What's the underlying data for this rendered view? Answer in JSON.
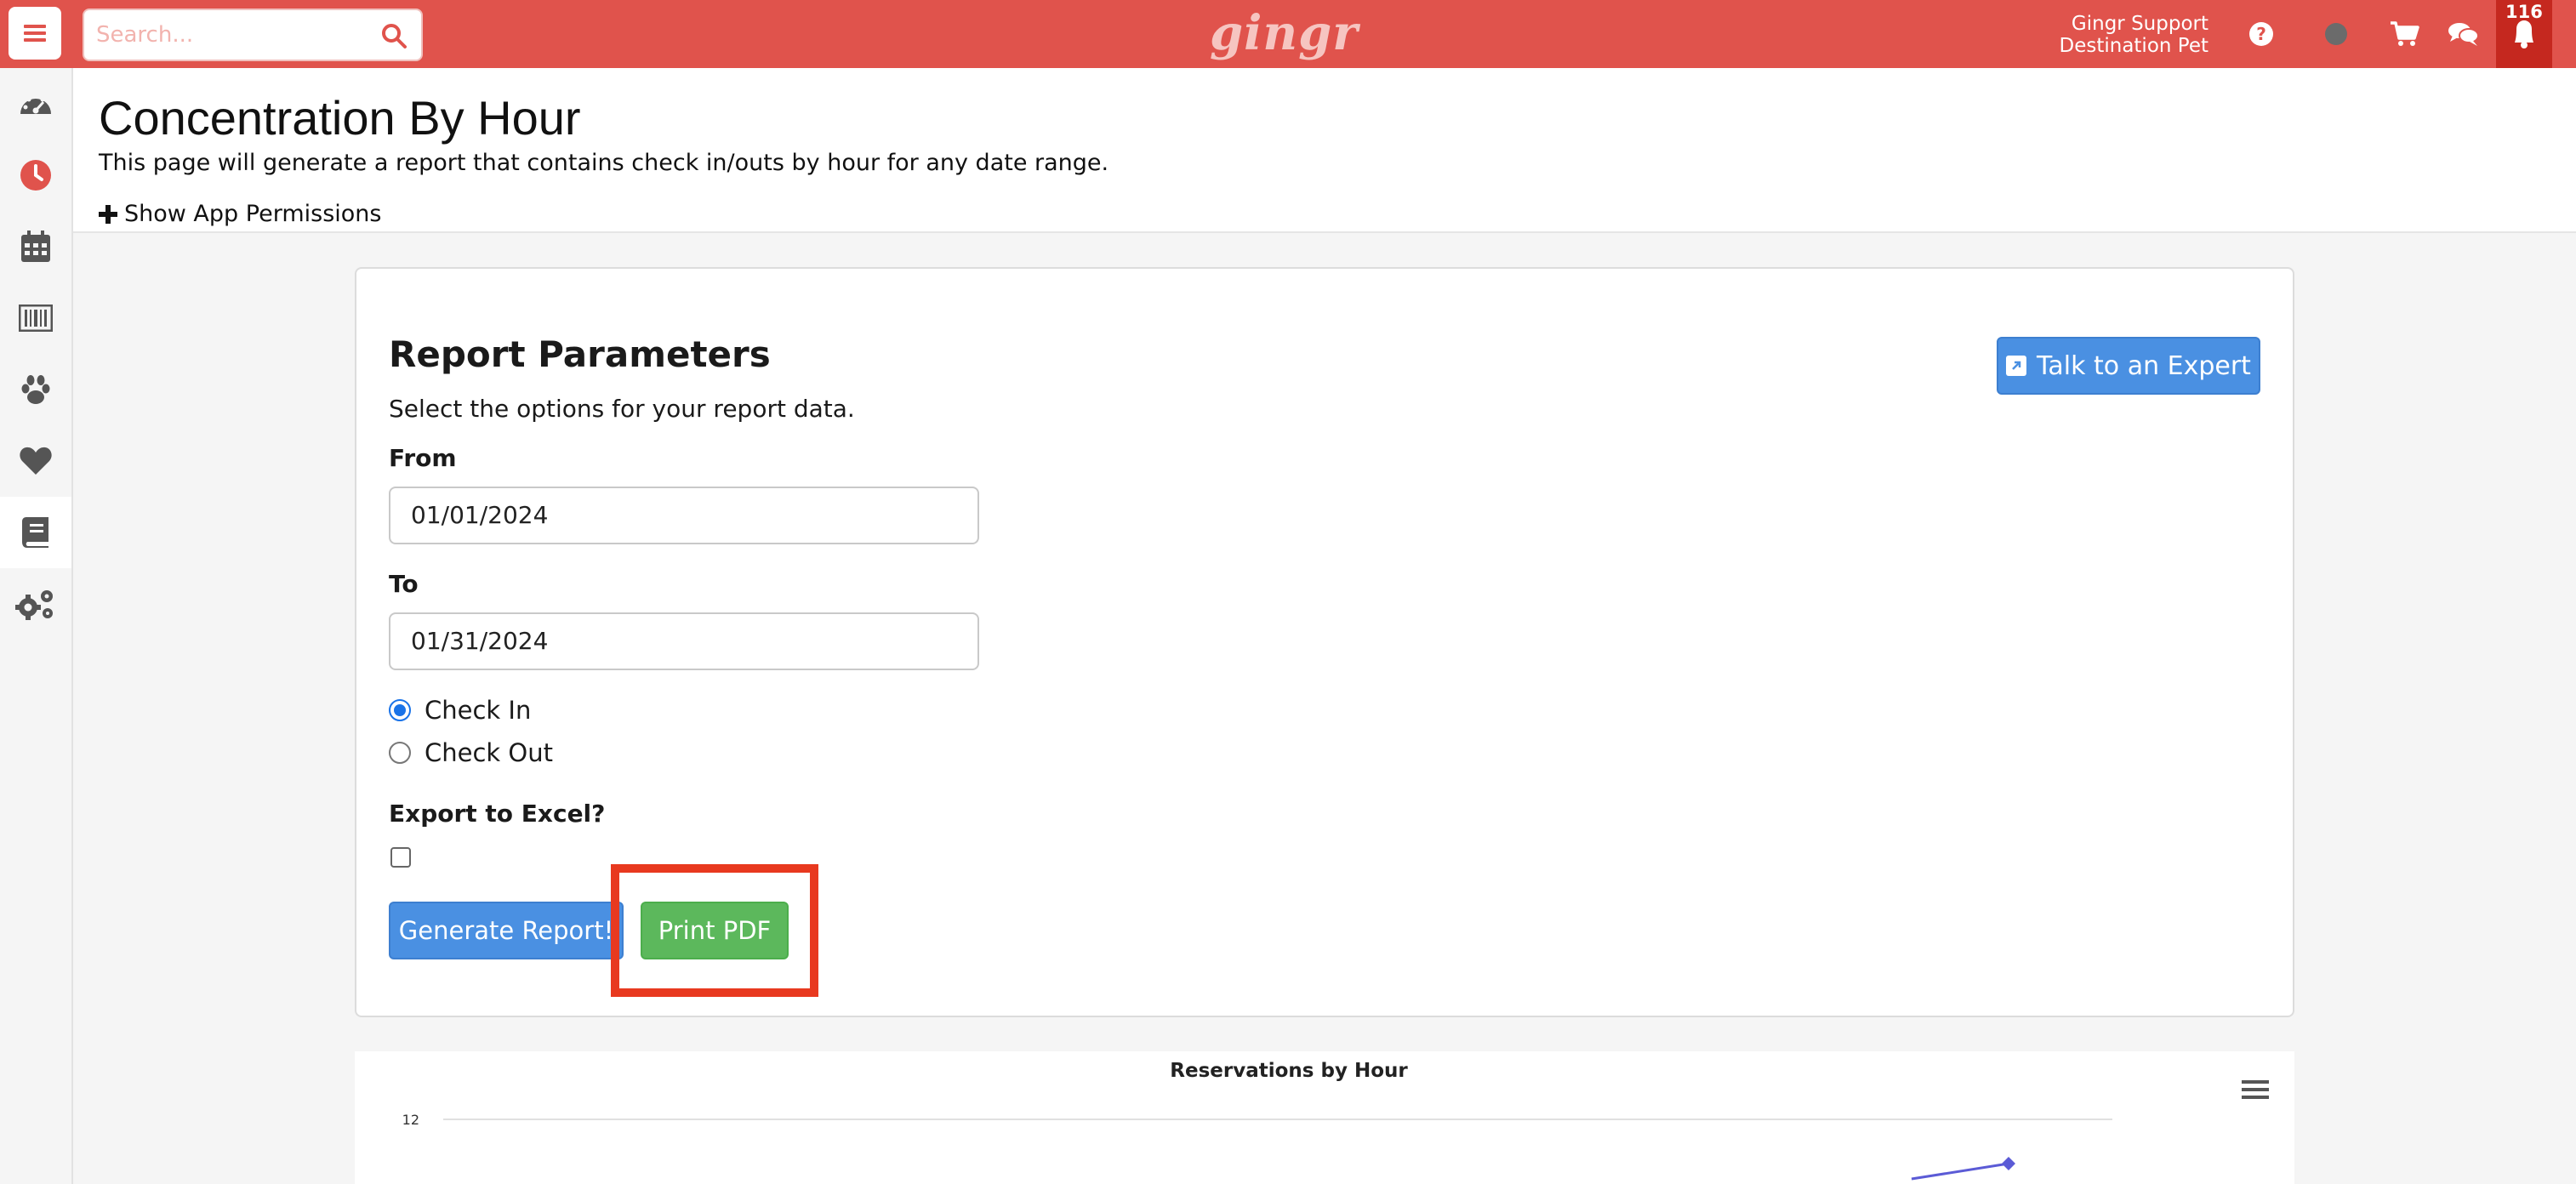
{
  "topbar": {
    "search_placeholder": "Search...",
    "logo_text": "gingr",
    "user_name": "Gingr Support",
    "location": "Destination Pet",
    "notification_count": "116",
    "accent_color": "#e0534c"
  },
  "sidebar": {
    "items": [
      {
        "icon": "dashboard-icon"
      },
      {
        "icon": "clock-icon"
      },
      {
        "icon": "calendar-icon"
      },
      {
        "icon": "barcode-icon"
      },
      {
        "icon": "paw-icon"
      },
      {
        "icon": "heart-icon"
      },
      {
        "icon": "book-icon"
      },
      {
        "icon": "gears-icon"
      }
    ]
  },
  "header": {
    "title": "Concentration By Hour",
    "description": "This page will generate a report that contains check in/outs by hour for any date range.",
    "permissions_link": "Show App Permissions"
  },
  "form": {
    "title": "Report Parameters",
    "subtitle": "Select the options for your report data.",
    "expert_button": "Talk to an Expert",
    "from_label": "From",
    "from_value": "01/01/2024",
    "to_label": "To",
    "to_value": "01/31/2024",
    "radio_check_in": "Check In",
    "radio_check_out": "Check Out",
    "selected_radio": "Check In",
    "export_label": "Export to Excel?",
    "export_checked": false,
    "generate_button": "Generate Report!",
    "pdf_button": "Print PDF"
  },
  "chart_data": {
    "type": "line",
    "title": "Reservations by Hour",
    "ytick_labels": [
      "12"
    ]
  }
}
